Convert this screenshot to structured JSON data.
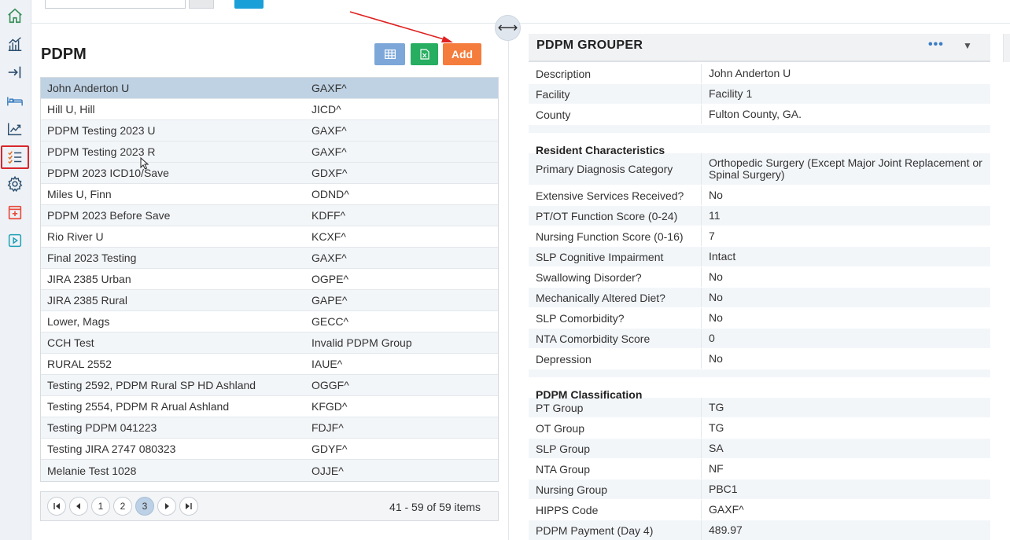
{
  "rail": {
    "items": [
      {
        "name": "home-icon"
      },
      {
        "name": "analytics-icon"
      },
      {
        "name": "sign-in-icon"
      },
      {
        "name": "bed-icon"
      },
      {
        "name": "trend-icon"
      },
      {
        "name": "checklist-icon",
        "active": true
      },
      {
        "name": "gear-icon"
      },
      {
        "name": "medical-kit-icon"
      },
      {
        "name": "play-icon"
      }
    ]
  },
  "left_panel": {
    "title": "PDPM",
    "buttons": {
      "grid_icon": "grid-icon",
      "excel_icon": "excel-icon",
      "add_label": "Add"
    },
    "rows": [
      {
        "name": "John Anderton U",
        "group": "GAXF^"
      },
      {
        "name": "Hill U, Hill",
        "group": "JICD^"
      },
      {
        "name": "PDPM Testing 2023 U",
        "group": "GAXF^"
      },
      {
        "name": "PDPM Testing 2023 R",
        "group": "GAXF^"
      },
      {
        "name": "PDPM 2023 ICD10/Save",
        "group": "GDXF^"
      },
      {
        "name": "Miles U, Finn",
        "group": "ODND^"
      },
      {
        "name": "PDPM 2023 Before Save",
        "group": "KDFF^"
      },
      {
        "name": "Rio River U",
        "group": "KCXF^"
      },
      {
        "name": "Final 2023 Testing",
        "group": "GAXF^"
      },
      {
        "name": "JIRA 2385 Urban",
        "group": "OGPE^"
      },
      {
        "name": "JIRA 2385 Rural",
        "group": "GAPE^"
      },
      {
        "name": "Lower, Mags",
        "group": "GECC^"
      },
      {
        "name": "CCH Test",
        "group": "Invalid PDPM Group"
      },
      {
        "name": "RURAL 2552",
        "group": "IAUE^"
      },
      {
        "name": "Testing 2592, PDPM Rural SP HD Ashland",
        "group": "OGGF^"
      },
      {
        "name": "Testing 2554, PDPM R Arual Ashland",
        "group": "KFGD^"
      },
      {
        "name": "Testing PDPM 041223",
        "group": "FDJF^"
      },
      {
        "name": "Testing JIRA 2747 080323",
        "group": "GDYF^"
      },
      {
        "name": "Melanie Test 1028",
        "group": "OJJE^"
      }
    ],
    "pager": {
      "pages": [
        "1",
        "2",
        "3"
      ],
      "current_page": "3",
      "info": "41 - 59 of 59 items"
    }
  },
  "splitter": {
    "icon": "resize-horizontal-icon",
    "glyph": "⟷"
  },
  "right_panel": {
    "title": "PDPM GROUPER",
    "more": "•••",
    "basic": [
      {
        "label": "Description",
        "value": "John Anderton U"
      },
      {
        "label": "Facility",
        "value": "Facility 1"
      },
      {
        "label": "County",
        "value": "Fulton County, GA."
      }
    ],
    "resident_section": "Resident Characteristics",
    "resident": [
      {
        "label": "Primary Diagnosis Category",
        "value": "Orthopedic Surgery (Except Major Joint Replacement or Spinal Surgery)"
      },
      {
        "label": "Extensive Services Received?",
        "value": "No"
      },
      {
        "label": "PT/OT Function Score (0-24)",
        "value": "11"
      },
      {
        "label": "Nursing Function Score (0-16)",
        "value": "7"
      },
      {
        "label": "SLP Cognitive Impairment",
        "value": "Intact"
      },
      {
        "label": "Swallowing Disorder?",
        "value": "No"
      },
      {
        "label": "Mechanically Altered Diet?",
        "value": "No"
      },
      {
        "label": "SLP Comorbidity?",
        "value": "No"
      },
      {
        "label": "NTA Comorbidity Score",
        "value": "0"
      },
      {
        "label": "Depression",
        "value": "No"
      }
    ],
    "classification_section": "PDPM Classification",
    "classification": [
      {
        "label": "PT Group",
        "value": "TG"
      },
      {
        "label": "OT Group",
        "value": "TG"
      },
      {
        "label": "SLP Group",
        "value": "SA"
      },
      {
        "label": "NTA Group",
        "value": "NF"
      },
      {
        "label": "Nursing Group",
        "value": "PBC1"
      },
      {
        "label": "HIPPS Code",
        "value": "GAXF^"
      },
      {
        "label": "PDPM Payment (Day 4)",
        "value": "489.97"
      }
    ]
  },
  "colors": {
    "add_button": "#f47c3c",
    "excel_button": "#27ae60",
    "grid_button": "#7ca7d8",
    "selected_row": "#bfd2e4",
    "rail_active_border": "#d9262c"
  }
}
